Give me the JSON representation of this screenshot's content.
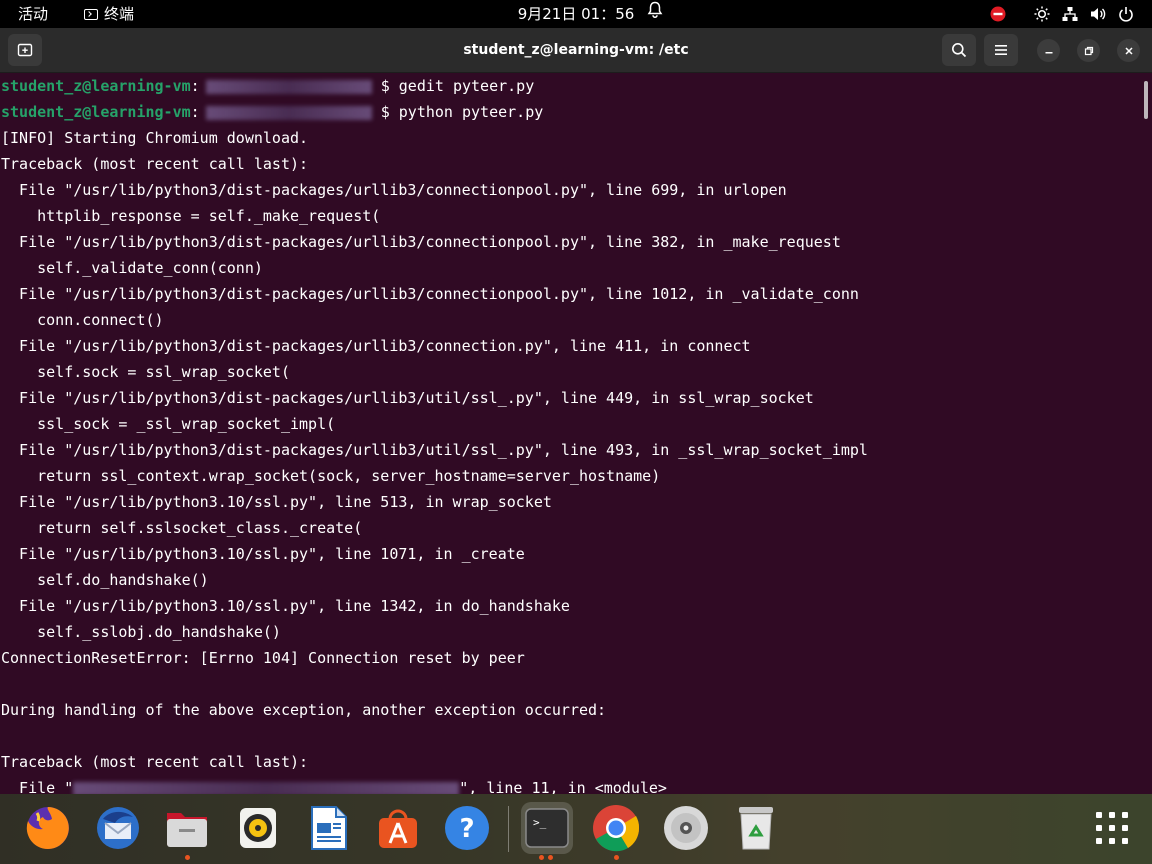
{
  "topbar": {
    "activities": "活动",
    "app_name": "终端",
    "clock": "9月21日 01：56",
    "tray_icons": [
      "do-not-disturb-icon",
      "brightness-icon",
      "network-icon",
      "volume-icon",
      "power-icon"
    ]
  },
  "window": {
    "title": "student_z@learning-vm: /etc",
    "buttons": [
      "new-tab-icon",
      "search-icon",
      "menu-icon",
      "minimize-icon",
      "maximize-icon",
      "close-icon"
    ]
  },
  "terminal": {
    "prompt_user": "student_z@learning-vm",
    "prompt_sep": ":",
    "cmd1": "$ gedit pyteer.py",
    "cmd2": "$ python pyteer.py",
    "lines": [
      "[INFO] Starting Chromium download.",
      "Traceback (most recent call last):",
      "  File \"/usr/lib/python3/dist-packages/urllib3/connectionpool.py\", line 699, in urlopen",
      "    httplib_response = self._make_request(",
      "  File \"/usr/lib/python3/dist-packages/urllib3/connectionpool.py\", line 382, in _make_request",
      "    self._validate_conn(conn)",
      "  File \"/usr/lib/python3/dist-packages/urllib3/connectionpool.py\", line 1012, in _validate_conn",
      "    conn.connect()",
      "  File \"/usr/lib/python3/dist-packages/urllib3/connection.py\", line 411, in connect",
      "    self.sock = ssl_wrap_socket(",
      "  File \"/usr/lib/python3/dist-packages/urllib3/util/ssl_.py\", line 449, in ssl_wrap_socket",
      "    ssl_sock = _ssl_wrap_socket_impl(",
      "  File \"/usr/lib/python3/dist-packages/urllib3/util/ssl_.py\", line 493, in _ssl_wrap_socket_impl",
      "    return ssl_context.wrap_socket(sock, server_hostname=server_hostname)",
      "  File \"/usr/lib/python3.10/ssl.py\", line 513, in wrap_socket",
      "    return self.sslsocket_class._create(",
      "  File \"/usr/lib/python3.10/ssl.py\", line 1071, in _create",
      "    self.do_handshake()",
      "  File \"/usr/lib/python3.10/ssl.py\", line 1342, in do_handshake",
      "    self._sslobj.do_handshake()",
      "ConnectionResetError: [Errno 104] Connection reset by peer",
      "",
      "During handling of the above exception, another exception occurred:",
      "",
      "Traceback (most recent call last):"
    ],
    "last_line_prefix": "  File \"",
    "last_line_suffix": "\", line 11, in <module>"
  },
  "dock": {
    "apps": [
      "firefox-icon",
      "thunderbird-icon",
      "files-icon",
      "rhythmbox-icon",
      "libreoffice-writer-icon",
      "ubuntu-software-icon",
      "help-icon",
      "terminal-icon",
      "chrome-icon",
      "dvd-icon",
      "trash-icon"
    ],
    "running": [
      "files-icon",
      "terminal-icon",
      "chrome-icon"
    ],
    "active": "terminal-icon",
    "grid": "show-apps-icon"
  },
  "colors": {
    "terminal_bg": "#300a24",
    "prompt_user": "#26a269",
    "accent": "#e95420"
  }
}
